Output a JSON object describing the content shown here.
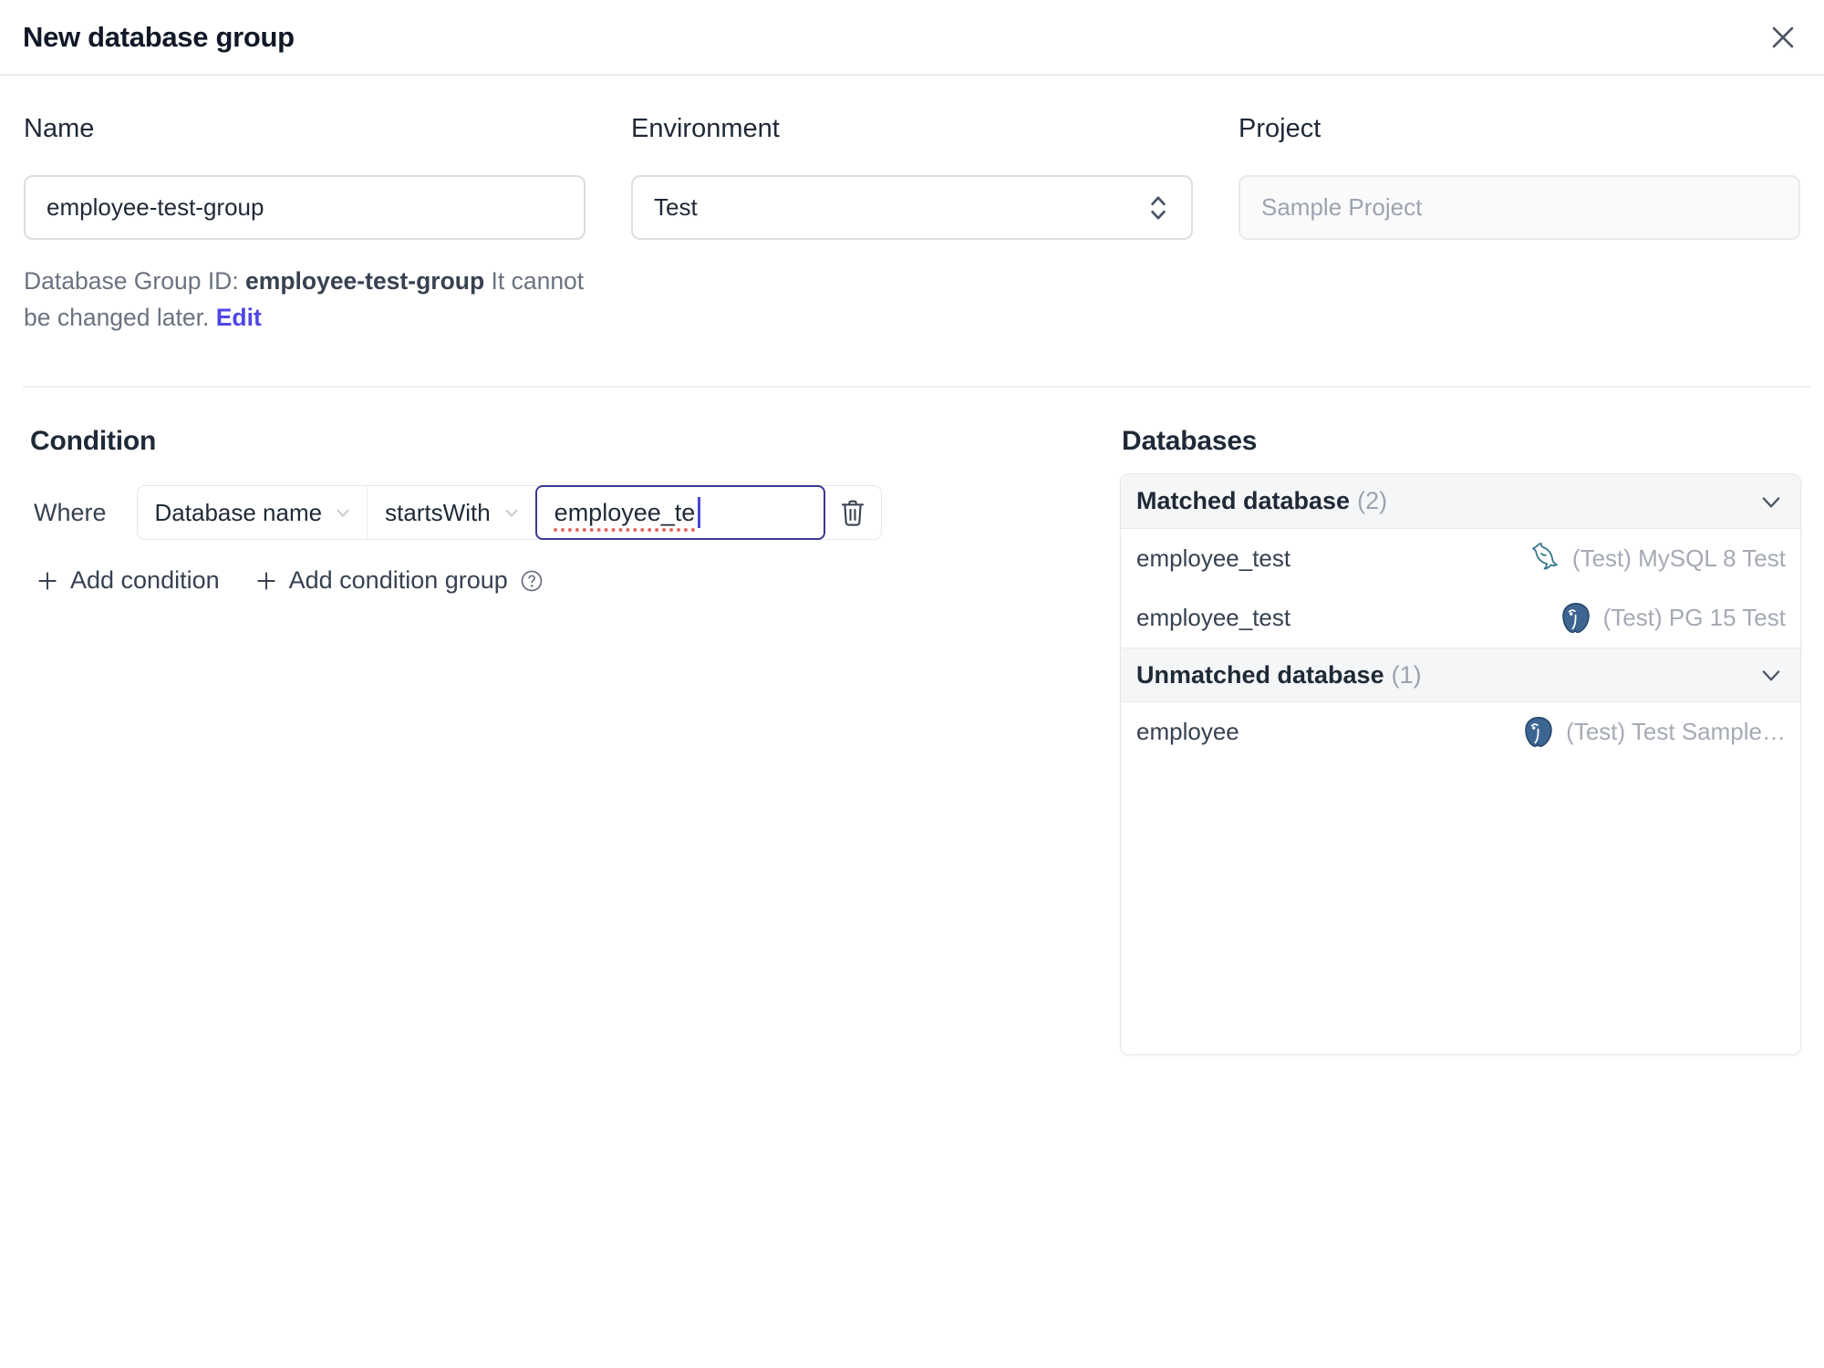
{
  "dialog": {
    "title": "New database group"
  },
  "form": {
    "name": {
      "label": "Name",
      "value": "employee-test-group"
    },
    "environment": {
      "label": "Environment",
      "value": "Test"
    },
    "project": {
      "label": "Project",
      "value": "Sample Project"
    },
    "helper": {
      "prefix": "Database Group ID: ",
      "id": "employee-test-group",
      "suffix": " It cannot be changed later.",
      "edit_label": "Edit"
    }
  },
  "condition": {
    "heading": "Condition",
    "where_label": "Where",
    "field_selected": "Database name",
    "operator_selected": "startsWith",
    "value": "employee_te",
    "add_condition_label": "Add condition",
    "add_condition_group_label": "Add condition group"
  },
  "databases": {
    "heading": "Databases",
    "groups": [
      {
        "title": "Matched database",
        "count": "(2)",
        "rows": [
          {
            "name": "employee_test",
            "engine": "mysql",
            "instance": "(Test) MySQL 8 Test"
          },
          {
            "name": "employee_test",
            "engine": "postgresql",
            "instance": "(Test) PG 15 Test"
          }
        ]
      },
      {
        "title": "Unmatched database",
        "count": "(1)",
        "rows": [
          {
            "name": "employee",
            "engine": "postgresql",
            "instance": "(Test) Test Sample…"
          }
        ]
      }
    ]
  },
  "icons": {
    "close-icon": "×",
    "chevron-updown-icon": "⇕",
    "chevron-down-icon": "⌄",
    "trash-icon": "trash-outline",
    "plus-icon": "+",
    "help-circle-icon": "?",
    "mysql-icon": "dolphin",
    "postgresql-icon": "elephant",
    "text-caret": "|"
  },
  "colors": {
    "accent": "#4F46E5",
    "focus_border": "#3B3792",
    "spellcheck_underline": "#E06B5F",
    "mysql_icon": "#35788C",
    "postgresql_icon": "#3D6591",
    "header_bg": "#F5F6F7",
    "border": "#E5E7EB",
    "muted_text": "#9CA3AF"
  }
}
